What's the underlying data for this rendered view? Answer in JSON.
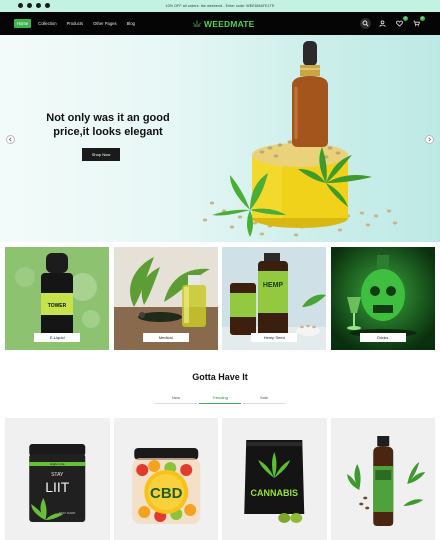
{
  "announcement": "10% OFF all orders: the weekend - Enter code: WEEDMATE1TE",
  "nav": {
    "items": [
      "Home",
      "Collection",
      "Products",
      "Other Pages",
      "Blog"
    ]
  },
  "logo": {
    "text": "WEEDMATE"
  },
  "header_icons": {
    "search": "search-icon",
    "account": "user-icon",
    "wishlist": "heart-icon",
    "cart": "cart-icon",
    "wishlist_count": "0",
    "cart_count": "0"
  },
  "hero": {
    "title": "Not only was it an good price,it looks elegant",
    "button": "Shop Now"
  },
  "categories": [
    "E-Liquid",
    "Medical",
    "Hemp Seed",
    "Drinks"
  ],
  "section": {
    "title": "Gotta Have It",
    "tabs": [
      "New",
      "Trending",
      "Sale"
    ],
    "active_tab": "Trending"
  },
  "product_art": {
    "p1_brand": "Higher Life",
    "p1_top": "STAY",
    "p1_mid": "LIIT",
    "p1_bot": "STAY DARK",
    "p2_text": "CBD",
    "p3_text": "CANNABIS",
    "e_liquid_label": "TOWER",
    "hemp_label": "HEMP"
  },
  "colors": {
    "accent": "#3fb34f",
    "header_bg": "#050505",
    "announce_bg": "#c4f2e2",
    "hero_bg": "#d9f3f0"
  }
}
